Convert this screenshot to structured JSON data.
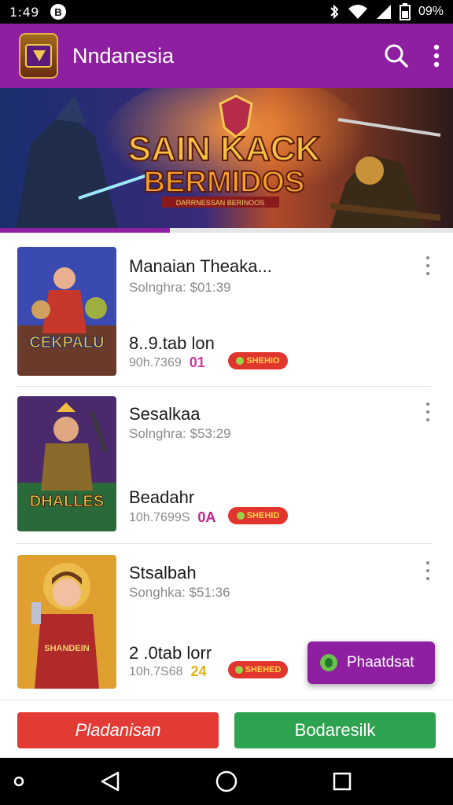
{
  "status_bar": {
    "time": "1:49",
    "notification_badge": "B",
    "battery_text": "09%",
    "icons": [
      "bluetooth-icon",
      "wifi-icon",
      "signal-icon",
      "battery-icon"
    ]
  },
  "app_bar": {
    "title": "Nndanesia",
    "icons": [
      "search-icon",
      "more-vert-icon"
    ]
  },
  "banner": {
    "title_line1": "SAIN KACK",
    "title_line2": "BERMIDOS",
    "subtitle": "DARRNESSAN BERINOOS",
    "progress": 0.375
  },
  "items": [
    {
      "thumb_label": "CEKPALU",
      "title": "Manaiаn Theaka...",
      "subtitle": "Solnghra: $01:39",
      "name": "8..9.tab lon",
      "meta": "90h.7369",
      "meta_accent": "01",
      "meta_accent_color": "#d23aa3",
      "tag": "SHEHIO"
    },
    {
      "thumb_label": "DHALLES",
      "title": "Sesalkaa",
      "subtitle": "Solnghra: $53:29",
      "name": "Beadahr",
      "meta": "10h.7699S",
      "meta_accent": "0A",
      "meta_accent_color": "#c0228a",
      "tag": "SHEHID"
    },
    {
      "thumb_label": "SHANDEIN",
      "title": "Stsalbah",
      "subtitle": "Songhka: $51:36",
      "name": "2 .0tab lorr",
      "meta": "10h.7S68",
      "meta_accent": "24",
      "meta_accent_color": "#e0b21a",
      "tag": "SHEHED"
    }
  ],
  "fab": {
    "label": "Phaatdsat"
  },
  "bottom_buttons": {
    "left_label": "Pladanisan",
    "right_label": "Bodaresilk"
  },
  "nav_bar": {
    "icons": [
      "dot-icon",
      "back-icon",
      "home-icon",
      "recents-icon"
    ]
  },
  "colors": {
    "primary": "#8e1fa0",
    "red_button": "#e23a35",
    "green_button": "#2ea34f"
  }
}
